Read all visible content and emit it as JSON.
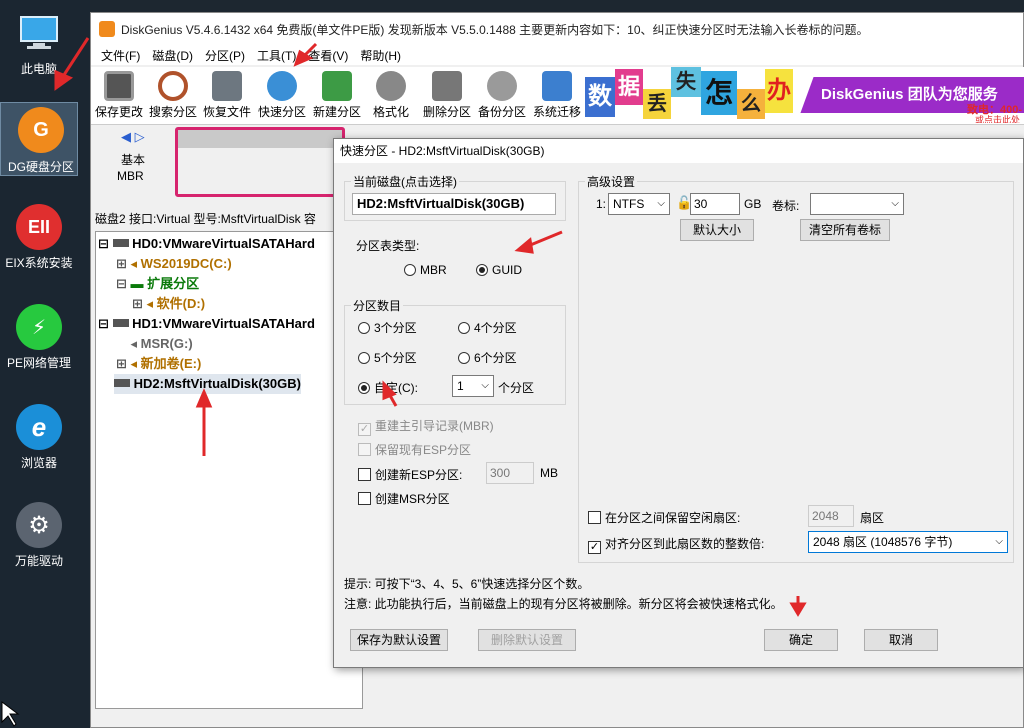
{
  "desktop": {
    "icons": [
      {
        "label": "此电脑"
      },
      {
        "label": "DG硬盘分区"
      },
      {
        "label": "EIX系统安装"
      },
      {
        "label": "PE网络管理"
      },
      {
        "label": "浏览器"
      },
      {
        "label": "万能驱动"
      }
    ]
  },
  "window": {
    "title": "DiskGenius V5.4.6.1432 x64 免费版(单文件PE版)   发现新版本 V5.5.0.1488   主要更新内容如下：10、纠正快速分区时无法输入长卷标的问题。",
    "menu": [
      "文件(F)",
      "磁盘(D)",
      "分区(P)",
      "工具(T)",
      "查看(V)",
      "帮助(H)"
    ],
    "toolbar": [
      "保存更改",
      "搜索分区",
      "恢复文件",
      "快速分区",
      "新建分区",
      "格式化",
      "删除分区",
      "备份分区",
      "系统迁移"
    ],
    "banner": {
      "chars": [
        "数",
        "据",
        "丢",
        "失",
        "怎",
        "么",
        "办"
      ],
      "slogan": "DiskGenius 团队为您服务",
      "phone": "致电：400-",
      "more": "或点击此处"
    },
    "disk": {
      "type1": "基本",
      "type2": "MBR"
    },
    "diskinfo": "磁盘2 接口:Virtual  型号:MsftVirtualDisk  容",
    "tree": [
      "HD0:VMwareVirtualSATAHard",
      "WS2019DC(C:)",
      "扩展分区",
      "软件(D:)",
      "HD1:VMwareVirtualSATAHard",
      "MSR(G:)",
      "新加卷(E:)",
      "HD2:MsftVirtualDisk(30GB)"
    ]
  },
  "dialog": {
    "title": "快速分区 - HD2:MsftVirtualDisk(30GB)",
    "current_disk_legend": "当前磁盘(点击选择)",
    "current_disk": "HD2:MsftVirtualDisk(30GB)",
    "pt_type_label": "分区表类型:",
    "mbr": "MBR",
    "guid": "GUID",
    "count_legend": "分区数目",
    "opt3": "3个分区",
    "opt4": "4个分区",
    "opt5": "5个分区",
    "opt6": "6个分区",
    "custom": "自定(C):",
    "custom_value": "1",
    "custom_unit": "个分区",
    "rebuild_mbr": "重建主引导记录(MBR)",
    "keep_esp": "保留现有ESP分区",
    "new_esp": "创建新ESP分区:",
    "esp_size": "300",
    "esp_unit": "MB",
    "new_msr": "创建MSR分区",
    "adv_legend": "高级设置",
    "row_index": "1:",
    "fs": "NTFS",
    "size": "30",
    "size_unit": "GB",
    "vol_label": "卷标:",
    "default_size": "默认大小",
    "clear_labels": "清空所有卷标",
    "keep_free": "在分区之间保留空闲扇区:",
    "free_sectors": "2048",
    "sector_unit": "扇区",
    "align": "对齐分区到此扇区数的整数倍:",
    "align_value": "2048 扇区 (1048576 字节)",
    "hint1": "提示: 可按下“3、4、5、6”快速选择分区个数。",
    "hint2": "注意: 此功能执行后，当前磁盘上的现有分区将被删除。新分区将会被快速格式化。",
    "save_default": "保存为默认设置",
    "delete_default": "删除默认设置",
    "ok": "确定",
    "cancel": "取消"
  },
  "colors": {
    "accent_red": "#e0282a",
    "disk_border": "#d6246e",
    "banner_purple": "#9b2bc8"
  }
}
